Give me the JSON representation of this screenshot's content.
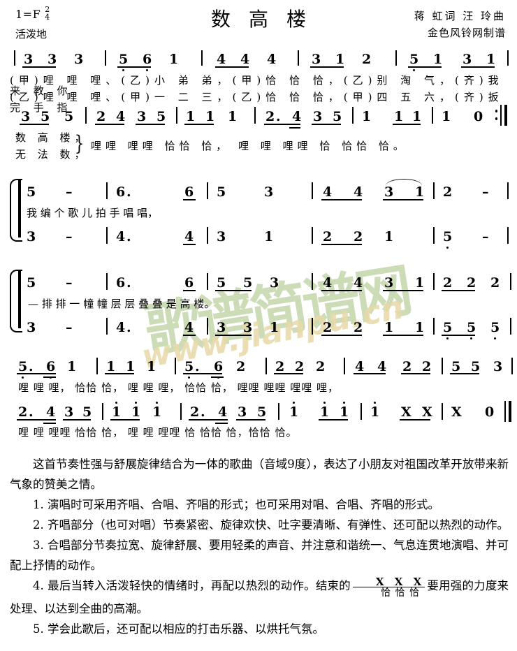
{
  "header": {
    "key_signature": "1=F",
    "meter_num": "2",
    "meter_den": "4",
    "tempo_mark": "活泼地",
    "title": "数高楼",
    "lyricist_composer": "蒋 虹词 汪 玲曲",
    "engraver": "金色风铃网制谱"
  },
  "watermark": {
    "cn_text": "歌谱简谱网",
    "url_text": "www.jianpu.cn",
    "cn_color": "#b9cf9a",
    "url_color": "#e8d9a8"
  },
  "score": {
    "systems": [
      {
        "id": "system-1",
        "measures": [
          {
            "notes": "3 3 3"
          },
          {
            "notes": "5 6 1"
          },
          {
            "notes": "4 4 4"
          },
          {
            "notes": "3 1 2"
          },
          {
            "notes": "5 1 3 1"
          }
        ],
        "lyric_line_1": "(甲)哩 哩 哩、(乙)小 弟 弟，(甲)恰 恰 恰，(乙)别 淘 气，(齐)我 来 教 你",
        "lyric_line_2": "(乙)哩 哩 哩、(甲)一 二 三，(乙)恰 恰 恰，(甲)四 五 六，(齐)扳 完 手 指"
      },
      {
        "id": "system-2",
        "measures": [
          {
            "notes": "3 5 5"
          },
          {
            "notes": "2 4 3 5"
          },
          {
            "notes": "1 1 1"
          },
          {
            "notes": "2. 4 3 5"
          },
          {
            "notes": "1 1 1"
          },
          {
            "notes": "1 0"
          }
        ],
        "lyric_line_1": "数 高 楼，",
        "lyric_line_2": "无 法 数，",
        "lyric_tail": "哩哩 哩哩  恰恰 恰，  哩 哩 哩哩  恰 恰恰  恰。"
      },
      {
        "id": "system-3",
        "voice_upper": [
          {
            "notes": "5 -"
          },
          {
            "notes": "6. 6"
          },
          {
            "notes": "5 3"
          },
          {
            "notes": "4 4 3 1"
          },
          {
            "notes": "2 -"
          }
        ],
        "voice_lower": [
          {
            "notes": "3 -"
          },
          {
            "notes": "4. 4"
          },
          {
            "notes": "3 1"
          },
          {
            "notes": "2 2 1"
          },
          {
            "notes": "5 -"
          }
        ],
        "lyrics": "我      编    个  歌  儿   拍 手 唱   唱，"
      },
      {
        "id": "system-4",
        "voice_upper": [
          {
            "notes": "5 -"
          },
          {
            "notes": "6. 6"
          },
          {
            "notes": "5 5 3"
          },
          {
            "notes": "4 4 3 1"
          },
          {
            "notes": "2 2 2"
          }
        ],
        "voice_lower": [
          {
            "notes": "3 -"
          },
          {
            "notes": "4. 4"
          },
          {
            "notes": "3 3 1"
          },
          {
            "notes": "2 2 1 1"
          },
          {
            "notes": "5 5 5"
          }
        ],
        "lyrics": "—     排   排 一 幢 幢  层 层 叠 叠 是 高 楼。"
      },
      {
        "id": "system-5",
        "measures": [
          {
            "notes": "5. 6 1"
          },
          {
            "notes": "1 1 1"
          },
          {
            "notes": "5. 6 2"
          },
          {
            "notes": "2 2 2"
          },
          {
            "notes": "4 4 2 2"
          },
          {
            "notes": "5 5 3"
          }
        ],
        "lyrics": "哩  哩 哩，  恰恰 恰，  哩  哩 哩，  恰恰 恰，  哩哩 哩哩  哩哩 哩，"
      },
      {
        "id": "system-6",
        "measures": [
          {
            "notes": "2. 4 3 5"
          },
          {
            "notes": "1 1 1"
          },
          {
            "notes": "2. 4 3 5"
          },
          {
            "notes": "1 1 1"
          },
          {
            "notes": "1 X X"
          },
          {
            "notes": "X 0"
          }
        ],
        "lyrics": "哩  哩 哩哩  恰恰 恰，  哩  哩 哩哩  恰  恰恰  恰，恰恰   恰。"
      }
    ]
  },
  "notes_text": {
    "intro": "这首节奏性强与舒展旋律结合为一体的歌曲（音域9度），表达了小朋友对祖国改革开放带来新气象的赞美之情。",
    "item1": "1. 演唱时可采用齐唱、合唱、齐唱的形式；也可采用对唱、合唱、齐唱的形式。",
    "item2": "2. 齐唱部分（也可对唱）节奏紧密、旋律欢快、吐字要清晰、有弹性、还可配以热烈的动作。",
    "item3": "3. 合唱部分节奏拉宽、旋律舒展、要用轻柔的声音、并注意和谐统一、气息连贯地演唱、并可配上抒情的动作。",
    "item4_part1": "4. 最后当转入活泼轻快的情绪时，再配以热烈的动作。结束的",
    "item4_perc_x": "X X X",
    "item4_perc_cn": "恰 恰 恰",
    "item4_part2": "要用强的力度来处理、以达到全曲的高潮。",
    "item5": "5. 学会此歌后，还可配以相应的打击乐器、以烘托气氛。"
  }
}
